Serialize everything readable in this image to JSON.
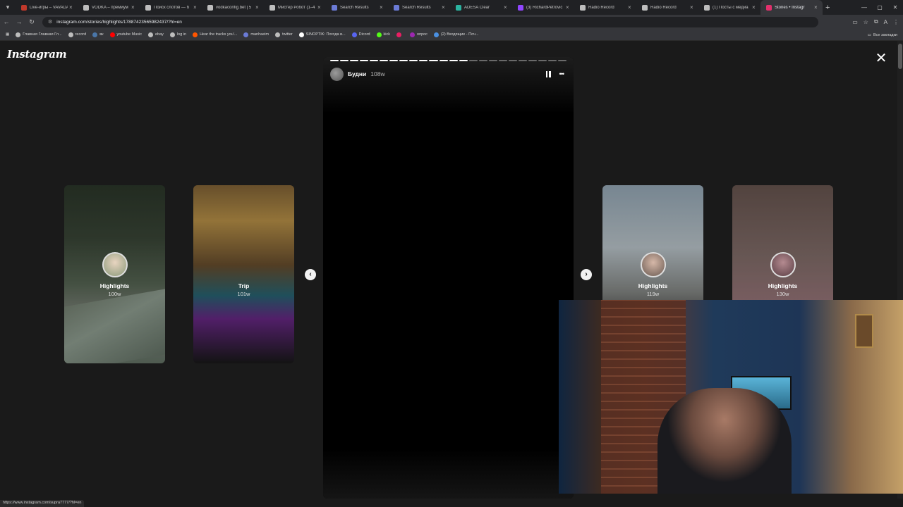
{
  "browser": {
    "tabs": [
      {
        "label": "Live-игры – VAVADA",
        "color": "#c0392b"
      },
      {
        "label": "VODKA – премиум",
        "color": "#bdbdbd"
      },
      {
        "label": "Поиск слотов — б",
        "color": "#bdbdbd"
      },
      {
        "label": "vodkaconfig.bet | 5",
        "color": "#bdbdbd"
      },
      {
        "label": "Мистер Робот (1–4",
        "color": "#bdbdbd"
      },
      {
        "label": "Search Results",
        "color": "#6b7bd6"
      },
      {
        "label": "Search Results",
        "color": "#6b7bd6"
      },
      {
        "label": "ADESA Clear",
        "color": "#2bb3a0"
      },
      {
        "label": "(3) RichardPetrovic",
        "color": "#9146ff"
      },
      {
        "label": "Radio Record",
        "color": "#bdbdbd"
      },
      {
        "label": "Radio Record",
        "color": "#bdbdbd"
      },
      {
        "label": "(1) Посты с медиа",
        "color": "#bdbdbd"
      },
      {
        "label": "Stories • Instagr",
        "color": "#e1306c",
        "active": true
      }
    ],
    "url": "instagram.com/stories/highlights/17887423565982437/?hl=en",
    "bookmarks": [
      {
        "label": "Главная Главная Гл...",
        "color": "#bdbdbd"
      },
      {
        "label": "record",
        "color": "#bdbdbd"
      },
      {
        "label": "вк",
        "color": "#4a76a8"
      },
      {
        "label": "youtube Music",
        "color": "#ff0000"
      },
      {
        "label": "ebay",
        "color": "#bdbdbd"
      },
      {
        "label": "log in",
        "color": "#bdbdbd"
      },
      {
        "label": "Hear the tracks you'...",
        "color": "#ff5500"
      },
      {
        "label": "manhaeim",
        "color": "#6b7bd6"
      },
      {
        "label": "twitter",
        "color": "#bdbdbd"
      },
      {
        "label": "SINOPTIK: Погода в...",
        "color": "#ffffff"
      },
      {
        "label": "Dicord",
        "color": "#5865f2"
      },
      {
        "label": "kick",
        "color": "#53fc18"
      },
      {
        "label": "",
        "color": "#e91e63"
      },
      {
        "label": "опрос",
        "color": "#9c27b0"
      },
      {
        "label": "(2) Входящие - Поч...",
        "color": "#4a90e2"
      }
    ],
    "bookmarks_folder": "Все закладки",
    "status_url": "https://www.instagram.com/supra7777/?hl=en"
  },
  "instagram": {
    "logo": "Instagram",
    "story": {
      "name": "Будни",
      "time": "108w",
      "segments_total": 24,
      "segments_done": 14
    },
    "thumbs": [
      {
        "title": "Highlights",
        "time": "100w"
      },
      {
        "title": "Trip",
        "time": "101w"
      },
      {
        "title": "Highlights",
        "time": "119w"
      },
      {
        "title": "Highlights",
        "time": "130w"
      }
    ]
  },
  "icons": {
    "close": "✕",
    "prev": "‹",
    "next": "›",
    "more": "•••"
  }
}
